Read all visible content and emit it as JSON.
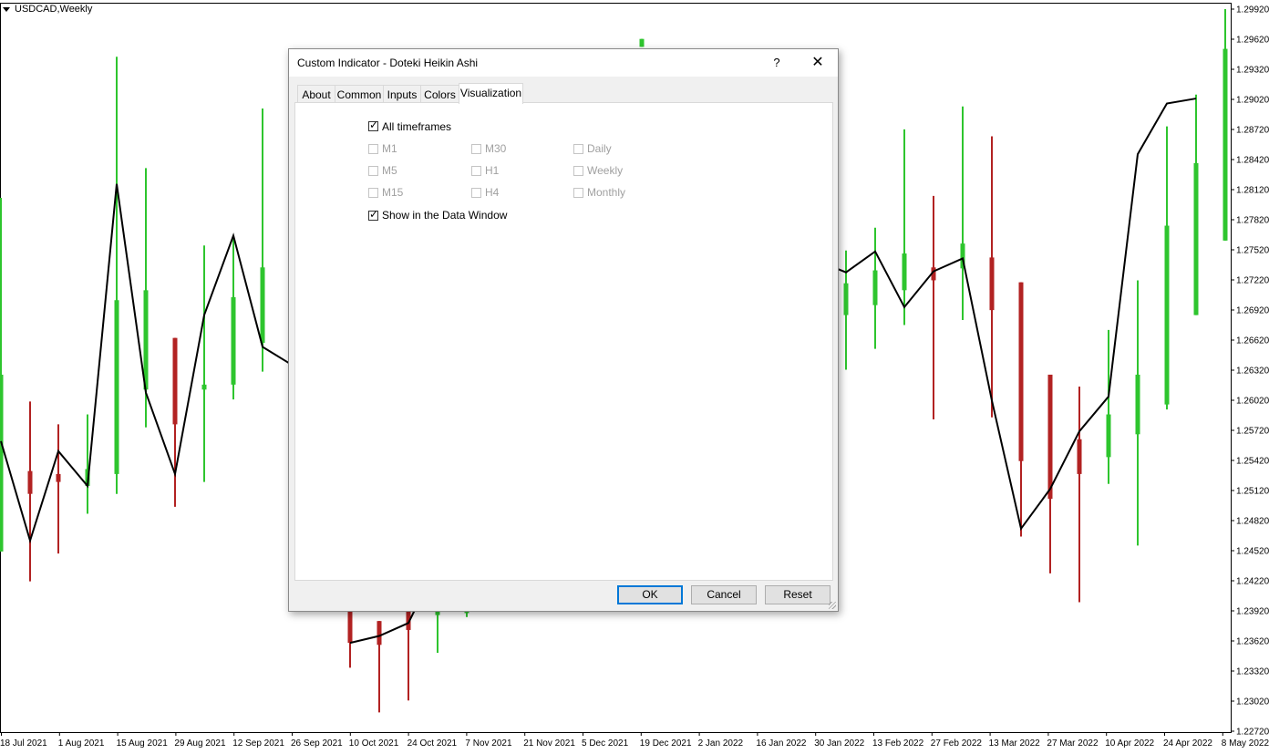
{
  "chart": {
    "symbol": "USDCAD,Weekly",
    "price_labels": [
      "1.29920",
      "1.29620",
      "1.29320",
      "1.29020",
      "1.28720",
      "1.28420",
      "1.28120",
      "1.27820",
      "1.27520",
      "1.27220",
      "1.26920",
      "1.26620",
      "1.26320",
      "1.26020",
      "1.25720",
      "1.25420",
      "1.25120",
      "1.24820",
      "1.24520",
      "1.24220",
      "1.23920",
      "1.23620",
      "1.23320",
      "1.23020",
      "1.22720"
    ],
    "date_labels": [
      "18 Jul 2021",
      "1 Aug 2021",
      "15 Aug 2021",
      "29 Aug 2021",
      "12 Sep 2021",
      "26 Sep 2021",
      "10 Oct 2021",
      "24 Oct 2021",
      "7 Nov 2021",
      "21 Nov 2021",
      "5 Dec 2021",
      "19 Dec 2021",
      "2 Jan 2022",
      "16 Jan 2022",
      "30 Jan 2022",
      "13 Feb 2022",
      "27 Feb 2022",
      "13 Mar 2022",
      "27 Mar 2022",
      "10 Apr 2022",
      "24 Apr 2022",
      "8 May 2022"
    ],
    "colors": {
      "bull": "#2ec52e",
      "bear": "#b22222",
      "line": "#000000",
      "grid_border": "#000000"
    }
  },
  "chart_data": {
    "type": "candlestick",
    "ylim": [
      1.2272,
      1.2998
    ],
    "candles": [
      {
        "dir": "bull",
        "high": 1.2808,
        "low": 1.2452,
        "open": 1.2452,
        "close": 1.263
      },
      {
        "dir": "bear",
        "high": 1.2603,
        "low": 1.2422,
        "open": 1.2533,
        "close": 1.251
      },
      {
        "dir": "bear",
        "high": 1.258,
        "low": 1.245,
        "open": 1.253,
        "close": 1.2522
      },
      {
        "dir": "bull",
        "high": 1.259,
        "low": 1.249,
        "open": 1.2518,
        "close": 1.2535
      },
      {
        "dir": "bull",
        "high": 1.295,
        "low": 1.251,
        "open": 1.253,
        "close": 1.2705
      },
      {
        "dir": "bull",
        "high": 1.2838,
        "low": 1.2577,
        "open": 1.2615,
        "close": 1.2715
      },
      {
        "dir": "bear",
        "high": 1.2667,
        "low": 1.2497,
        "open": 1.2667,
        "close": 1.258
      },
      {
        "dir": "bull",
        "high": 1.276,
        "low": 1.2522,
        "open": 1.2615,
        "close": 1.262
      },
      {
        "dir": "bull",
        "high": 1.277,
        "low": 1.2605,
        "open": 1.262,
        "close": 1.2708
      },
      {
        "dir": "bull",
        "high": 1.2898,
        "low": 1.2633,
        "open": 1.2662,
        "close": 1.2738
      },
      {
        "dir": "bear",
        "high": 1.2395,
        "low": 1.2335,
        "open": 1.2395,
        "close": 1.236
      },
      {
        "dir": "bear",
        "high": 1.2382,
        "low": 1.229,
        "open": 1.2382,
        "close": 1.2358
      },
      {
        "dir": "bear",
        "high": 1.2392,
        "low": 1.2302,
        "open": 1.2392,
        "close": 1.2373
      },
      {
        "dir": "bull",
        "high": 1.2395,
        "low": 1.235,
        "open": 1.2388,
        "close": 1.2395
      },
      {
        "dir": "bull",
        "high": 1.2395,
        "low": 1.2386,
        "open": 1.239,
        "close": 1.2395
      },
      {
        "dir": "bull",
        "high": 1.2968,
        "low": 1.296,
        "open": 1.296,
        "close": 1.2968
      },
      {
        "dir": "bull",
        "high": 1.2755,
        "low": 1.2635,
        "open": 1.269,
        "close": 1.2722
      },
      {
        "dir": "bull",
        "high": 1.2778,
        "low": 1.2656,
        "open": 1.27,
        "close": 1.2735
      },
      {
        "dir": "bull",
        "high": 1.2877,
        "low": 1.268,
        "open": 1.2715,
        "close": 1.2752
      },
      {
        "dir": "bear",
        "high": 1.281,
        "low": 1.2585,
        "open": 1.2738,
        "close": 1.2725
      },
      {
        "dir": "bull",
        "high": 1.29,
        "low": 1.2685,
        "open": 1.2737,
        "close": 1.2762
      },
      {
        "dir": "bear",
        "high": 1.287,
        "low": 1.2587,
        "open": 1.2748,
        "close": 1.2695
      },
      {
        "dir": "bear",
        "high": 1.2723,
        "low": 1.2467,
        "open": 1.2723,
        "close": 1.2543
      },
      {
        "dir": "bear",
        "high": 1.263,
        "low": 1.243,
        "open": 1.263,
        "close": 1.2505
      },
      {
        "dir": "bear",
        "high": 1.2618,
        "low": 1.2401,
        "open": 1.2565,
        "close": 1.253
      },
      {
        "dir": "bull",
        "high": 1.2675,
        "low": 1.252,
        "open": 1.2547,
        "close": 1.259
      },
      {
        "dir": "bull",
        "high": 1.2725,
        "low": 1.2458,
        "open": 1.257,
        "close": 1.263
      },
      {
        "dir": "bull",
        "high": 1.288,
        "low": 1.2595,
        "open": 1.26,
        "close": 1.278
      },
      {
        "dir": "bull",
        "high": 1.2912,
        "low": 1.269,
        "open": 1.269,
        "close": 1.2843
      },
      {
        "dir": "bull",
        "high": 1.2998,
        "low": 1.2765,
        "open": 1.2765,
        "close": 1.2958
      }
    ],
    "line": [
      [
        1.2563,
        1.2463,
        1.2553,
        1.2518,
        1.2822,
        1.2612,
        1.253,
        1.269,
        1.277,
        1.2658,
        1.264
      ],
      [
        1.236,
        1.2367,
        1.238,
        1.2395
      ],
      [
        1.2745,
        1.2733,
        1.2754,
        1.2698,
        1.2734,
        1.2747,
        1.2604,
        1.2475,
        1.2515,
        1.2573,
        1.2608,
        1.2852,
        1.2903,
        1.2908
      ]
    ]
  },
  "dialog": {
    "title": "Custom Indicator - Doteki Heikin Ashi",
    "help": "?",
    "close": "✕",
    "tabs": [
      "About",
      "Common",
      "Inputs",
      "Colors",
      "Visualization"
    ],
    "active_tab": "Visualization",
    "all_timeframes": {
      "label": "All timeframes",
      "checked": true
    },
    "timeframes": [
      {
        "label": "M1",
        "checked": false
      },
      {
        "label": "M30",
        "checked": false
      },
      {
        "label": "Daily",
        "checked": false
      },
      {
        "label": "M5",
        "checked": false
      },
      {
        "label": "H1",
        "checked": false
      },
      {
        "label": "Weekly",
        "checked": false
      },
      {
        "label": "M15",
        "checked": false
      },
      {
        "label": "H4",
        "checked": false
      },
      {
        "label": "Monthly",
        "checked": false
      }
    ],
    "data_window": {
      "label": "Show in the Data Window",
      "checked": true
    },
    "buttons": {
      "ok": "OK",
      "cancel": "Cancel",
      "reset": "Reset"
    }
  }
}
